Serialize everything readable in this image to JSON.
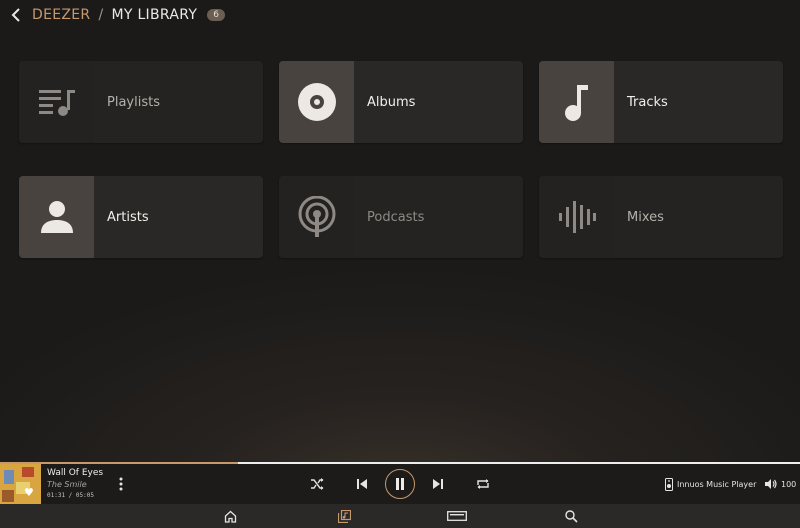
{
  "header": {
    "root": "DEEZER",
    "separator": "/",
    "current": "MY LIBRARY",
    "count": "6"
  },
  "tiles": [
    {
      "label": "Playlists",
      "icon": "playlist-icon"
    },
    {
      "label": "Albums",
      "icon": "album-disc-icon"
    },
    {
      "label": "Tracks",
      "icon": "music-note-icon"
    },
    {
      "label": "Artists",
      "icon": "person-icon"
    },
    {
      "label": "Podcasts",
      "icon": "podcast-icon"
    },
    {
      "label": "Mixes",
      "icon": "sound-wave-icon"
    }
  ],
  "player": {
    "track_title": "Wall Of Eyes",
    "artist": "The Smile",
    "time": "01:31 / 05:05",
    "progress": 0.298,
    "device": "Innuos Music Player",
    "volume": "100",
    "state": "playing"
  },
  "colors": {
    "accent": "#c69a6d",
    "tile": "#252321",
    "tile_icon_highlight": "#48433e",
    "player_bg": "#1c1b1a",
    "nav_bg": "#2a2928"
  },
  "nav": [
    "home-icon",
    "library-icon",
    "now-playing-icon",
    "search-icon"
  ]
}
